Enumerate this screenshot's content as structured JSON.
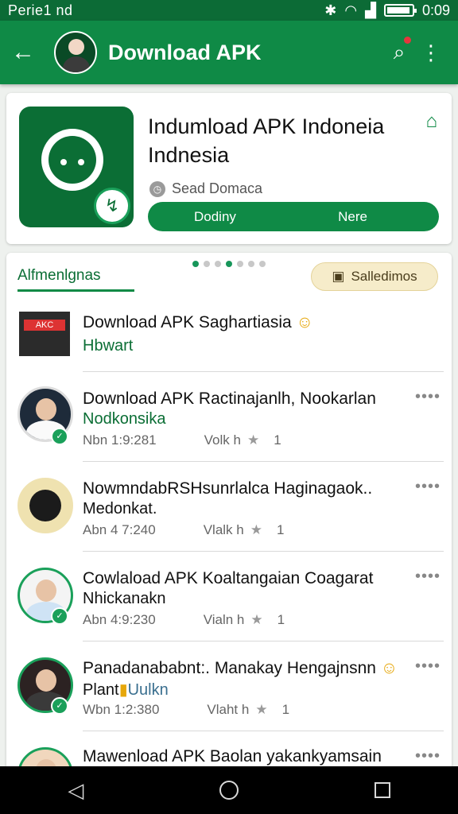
{
  "status_bar": {
    "carrier": "Perie1 nd",
    "time": "0:09"
  },
  "app_bar": {
    "title": "Download APK",
    "back_icon": "arrow-left-icon",
    "search_icon": "search-icon",
    "more_icon": "more-vert-icon"
  },
  "hero": {
    "title_line1": "Indumload APK Indoneia",
    "title_line2": "Indnesia",
    "subtitle": "Sead Domaca",
    "button_left": "Dodiny",
    "button_right": "Nere"
  },
  "feed": {
    "tab_label": "Alfmenlgnas",
    "chip_label": "Salledimos",
    "items": [
      {
        "title": "Download APK Saghartiasia",
        "subtitle": "Hbwart",
        "time": "",
        "views": "",
        "count": "",
        "thumb_label": "AKC",
        "emoji": "☺"
      },
      {
        "title": "Download APK Ractinajanlh, Nookarlan",
        "subtitle": "Nodkonsika",
        "time": "Nbn 1:9:281",
        "views": "Volk h",
        "count": "1"
      },
      {
        "title": "NowmndabRSHsunrlalca Haginagaok..",
        "subtitle": "Medonkat.",
        "time": "Abn 4 7:240",
        "views": "Vlalk h",
        "count": "1"
      },
      {
        "title": "Cowlaload APK Koaltangaian Coagarat",
        "subtitle": "Nhickanakn",
        "time": "Abn 4:9:230",
        "views": "Vialn h",
        "count": "1"
      },
      {
        "title": "Panadanababnt:. Manakay Hengajnsnn",
        "subtitle": "Plant",
        "subtitle2": "Uulkn",
        "time": "Wbn 1:2:380",
        "views": "Vlaht h",
        "count": "1",
        "emoji": "☺"
      },
      {
        "title": "Mawenload APK Baolan yakankyamsain"
      }
    ]
  },
  "colors": {
    "primary": "#0f8a46",
    "primary_dark": "#0c6b36",
    "accent": "#1aa05a",
    "chip_bg": "#f6ecca"
  }
}
